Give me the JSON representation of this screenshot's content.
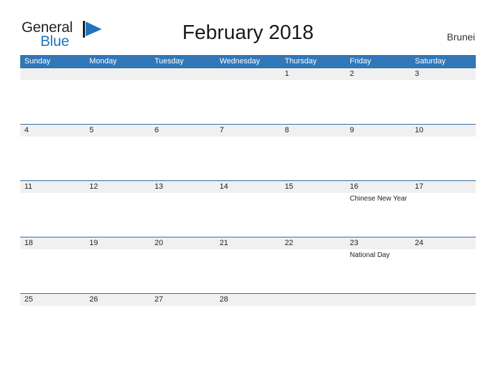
{
  "brand": {
    "word_one": "General",
    "word_two": "Blue",
    "flag_icon": "blue-flag-triangle-icon",
    "accent_color": "#1f74bd"
  },
  "header": {
    "title": "February 2018",
    "region": "Brunei"
  },
  "theme": {
    "header_blue": "#3277b8",
    "row_divider_blue": "#2e6da4",
    "band_gray": "#f0f0f0",
    "text_dark": "#222222"
  },
  "calendar": {
    "weekdays": [
      "Sunday",
      "Monday",
      "Tuesday",
      "Wednesday",
      "Thursday",
      "Friday",
      "Saturday"
    ],
    "weeks": [
      {
        "days": [
          {
            "num": "",
            "event": ""
          },
          {
            "num": "",
            "event": ""
          },
          {
            "num": "",
            "event": ""
          },
          {
            "num": "",
            "event": ""
          },
          {
            "num": "1",
            "event": ""
          },
          {
            "num": "2",
            "event": ""
          },
          {
            "num": "3",
            "event": ""
          }
        ]
      },
      {
        "days": [
          {
            "num": "4",
            "event": ""
          },
          {
            "num": "5",
            "event": ""
          },
          {
            "num": "6",
            "event": ""
          },
          {
            "num": "7",
            "event": ""
          },
          {
            "num": "8",
            "event": ""
          },
          {
            "num": "9",
            "event": ""
          },
          {
            "num": "10",
            "event": ""
          }
        ]
      },
      {
        "days": [
          {
            "num": "11",
            "event": ""
          },
          {
            "num": "12",
            "event": ""
          },
          {
            "num": "13",
            "event": ""
          },
          {
            "num": "14",
            "event": ""
          },
          {
            "num": "15",
            "event": ""
          },
          {
            "num": "16",
            "event": "Chinese New Year"
          },
          {
            "num": "17",
            "event": ""
          }
        ]
      },
      {
        "days": [
          {
            "num": "18",
            "event": ""
          },
          {
            "num": "19",
            "event": ""
          },
          {
            "num": "20",
            "event": ""
          },
          {
            "num": "21",
            "event": ""
          },
          {
            "num": "22",
            "event": ""
          },
          {
            "num": "23",
            "event": "National Day"
          },
          {
            "num": "24",
            "event": ""
          }
        ]
      },
      {
        "days": [
          {
            "num": "25",
            "event": ""
          },
          {
            "num": "26",
            "event": ""
          },
          {
            "num": "27",
            "event": ""
          },
          {
            "num": "28",
            "event": ""
          },
          {
            "num": "",
            "event": ""
          },
          {
            "num": "",
            "event": ""
          },
          {
            "num": "",
            "event": ""
          }
        ]
      }
    ]
  }
}
